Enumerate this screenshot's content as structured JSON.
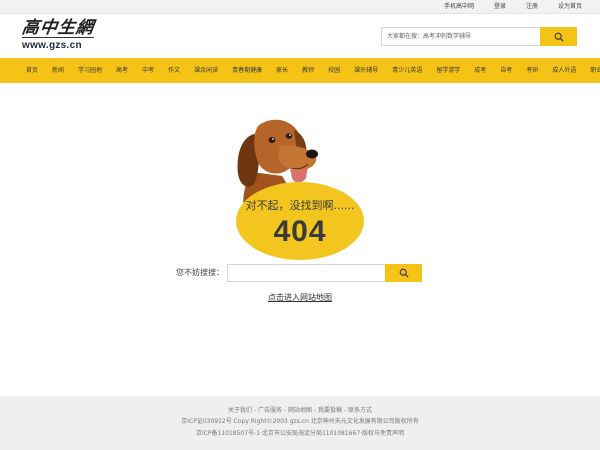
{
  "topbar": {
    "links": [
      "手机高中网",
      "登录",
      "注册",
      "设为首页"
    ]
  },
  "logo": {
    "calligraphy": "高中生網",
    "url": "www.gzs.cn"
  },
  "header_search": {
    "placeholder": "大家都在搜：高考冲刺数学辅导",
    "button_icon": "search-icon"
  },
  "nav": {
    "items": [
      "首页",
      "新闻",
      "学习园地",
      "高考",
      "中考",
      "作文",
      "课余闲读",
      "青春期健康",
      "家长",
      "教师",
      "校园",
      "课外辅导",
      "青少儿英语",
      "留学游学",
      "成考",
      "自考",
      "考研",
      "成人外语",
      "职业培训"
    ]
  },
  "error": {
    "message": "对不起，没找到啊......",
    "code": "404"
  },
  "search": {
    "label": "您不妨搜搜：",
    "value": "",
    "button_icon": "search-icon"
  },
  "sitemap_link": "点击进入网站地图",
  "footer": {
    "links_line": "关于我们 - 广告服务 - 网站地图 - 我要投稿 - 联系方式",
    "copyright_line": "京ICP证030912号 Copy Right©2003 gzs.cn 北京神州天元文化发展有限公司版权所有",
    "record_line": "京ICP备11018507号-1·北京市公安局海淀分局1101081667·版权与免责声明"
  },
  "colors": {
    "accent": "#f5c316",
    "ellipse": "#f2c61f",
    "footer_bg": "#efefef"
  }
}
